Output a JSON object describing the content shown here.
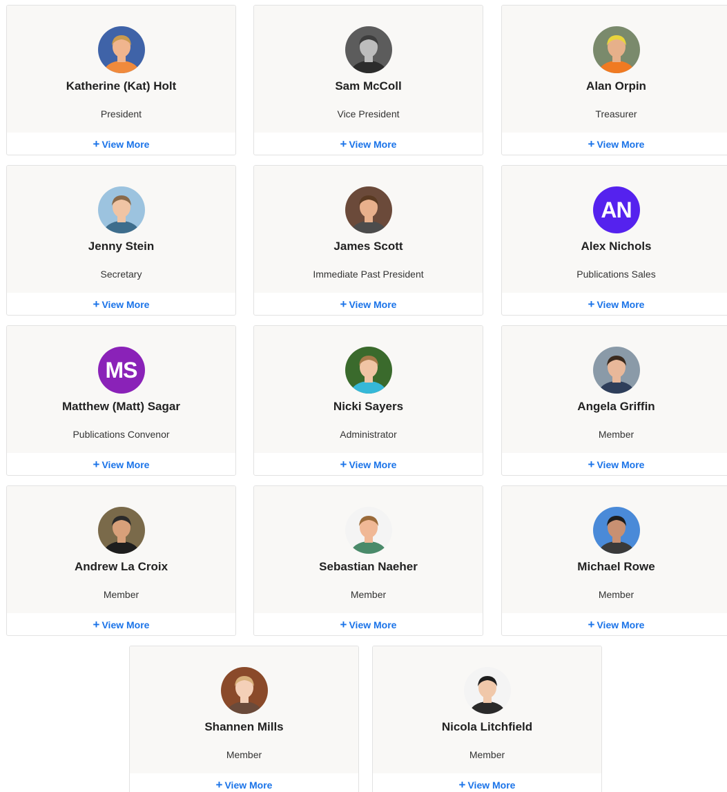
{
  "link_label": "View More",
  "members": [
    {
      "name": "Katherine (Kat) Holt",
      "role": "President",
      "avatar": {
        "kind": "photo",
        "bg": "#3f63a8",
        "skin": "#f0b58e",
        "hair": "#c99a4e",
        "shirt": "#f08a3c"
      }
    },
    {
      "name": "Sam McColl",
      "role": "Vice President",
      "avatar": {
        "kind": "photo",
        "bg": "#5c5c5c",
        "skin": "#bdbdbd",
        "hair": "#3d3d3d",
        "shirt": "#2c2c2c"
      }
    },
    {
      "name": "Alan Orpin",
      "role": "Treasurer",
      "avatar": {
        "kind": "photo",
        "bg": "#7a8a6c",
        "skin": "#e6b08a",
        "hair": "#e8d43c",
        "shirt": "#f07a22"
      }
    },
    {
      "name": "Jenny Stein",
      "role": "Secretary",
      "avatar": {
        "kind": "photo",
        "bg": "#9cc3df",
        "skin": "#f0c4a4",
        "hair": "#8a6a4a",
        "shirt": "#3e6d8c"
      }
    },
    {
      "name": "James Scott",
      "role": "Immediate Past President",
      "avatar": {
        "kind": "photo",
        "bg": "#6b4a3a",
        "skin": "#e8b08c",
        "hair": "#5a3a22",
        "shirt": "#4c4c4c"
      }
    },
    {
      "name": "Alex Nichols",
      "role": "Publications Sales",
      "avatar": {
        "kind": "initials",
        "text": "AN",
        "bg": "#5522ee"
      }
    },
    {
      "name": "Matthew (Matt) Sagar",
      "role": "Publications Convenor",
      "avatar": {
        "kind": "initials",
        "text": "MS",
        "bg": "#8a22b8"
      }
    },
    {
      "name": "Nicki Sayers",
      "role": "Administrator",
      "avatar": {
        "kind": "photo",
        "bg": "#3a6a2c",
        "skin": "#f0c4a4",
        "hair": "#a87a4a",
        "shirt": "#36b8d8"
      }
    },
    {
      "name": "Angela Griffin",
      "role": "Member",
      "avatar": {
        "kind": "photo",
        "bg": "#8a9aa8",
        "skin": "#e8b89a",
        "hair": "#3a2a1e",
        "shirt": "#2e3e5a"
      }
    },
    {
      "name": "Andrew La Croix",
      "role": "Member",
      "avatar": {
        "kind": "photo",
        "bg": "#7a6a4a",
        "skin": "#d8a07a",
        "hair": "#2a2a2a",
        "shirt": "#1e1e1e"
      }
    },
    {
      "name": "Sebastian Naeher",
      "role": "Member",
      "avatar": {
        "kind": "photo",
        "bg": "#f4f4f4",
        "skin": "#f0b896",
        "hair": "#9a6a3a",
        "shirt": "#4a8a6a"
      }
    },
    {
      "name": "Michael Rowe",
      "role": "Member",
      "avatar": {
        "kind": "photo",
        "bg": "#4a8ad8",
        "skin": "#c89072",
        "hair": "#1e1e1e",
        "shirt": "#3a3a3a"
      }
    },
    {
      "name": "Shannen Mills",
      "role": "Member",
      "avatar": {
        "kind": "photo",
        "bg": "#8a4a2a",
        "skin": "#f4d0b8",
        "hair": "#d8b07a",
        "shirt": "#6a4a3a"
      }
    },
    {
      "name": "Nicola Litchfield",
      "role": "Member",
      "avatar": {
        "kind": "photo",
        "bg": "#f4f4f4",
        "skin": "#f0c8aa",
        "hair": "#1e1e1e",
        "shirt": "#2a2a2a"
      }
    }
  ]
}
